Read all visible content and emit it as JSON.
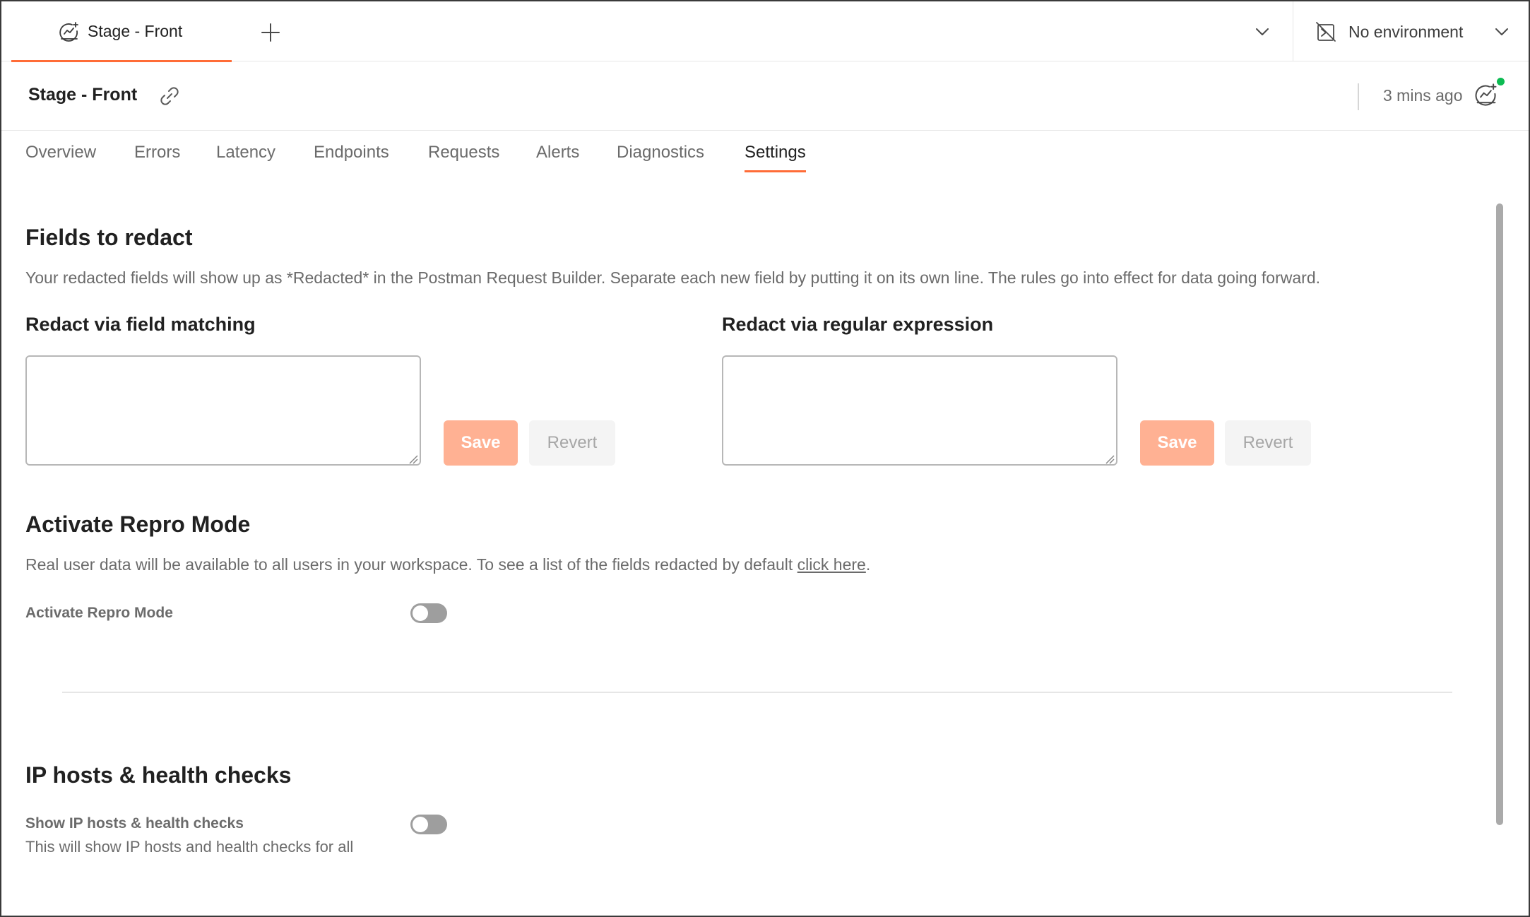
{
  "tabbar": {
    "tab_label": "Stage - Front",
    "environment_label": "No environment"
  },
  "header": {
    "title": "Stage - Front",
    "last_updated": "3 mins ago"
  },
  "nav": {
    "items": [
      "Overview",
      "Errors",
      "Latency",
      "Endpoints",
      "Requests",
      "Alerts",
      "Diagnostics",
      "Settings"
    ],
    "active": "Settings"
  },
  "redact": {
    "title": "Fields to redact",
    "description": "Your redacted fields will show up as *Redacted* in the Postman Request Builder. Separate each new field by putting it on its own line. The rules go into effect for data going forward.",
    "field_matching": {
      "title": "Redact via field matching",
      "value": "",
      "save_label": "Save",
      "revert_label": "Revert"
    },
    "regex": {
      "title": "Redact via regular expression",
      "value": "",
      "save_label": "Save",
      "revert_label": "Revert"
    }
  },
  "repro": {
    "title": "Activate Repro Mode",
    "description_prefix": "Real user data will be available to all users in your workspace. To see a list of the fields redacted by default ",
    "link_text": "click here",
    "description_suffix": ".",
    "toggle_label": "Activate Repro Mode",
    "toggle_on": false
  },
  "ip_hosts": {
    "title": "IP hosts & health checks",
    "toggle_label": "Show IP hosts & health checks",
    "toggle_description": "This will show IP hosts and health checks for all",
    "toggle_on": false
  },
  "colors": {
    "accent": "#ff6c37",
    "save_button": "#ffb193",
    "status_online": "#0cbb52"
  },
  "icons": {
    "tab": "monitor-icon",
    "add": "plus-icon",
    "dropdown": "chevron-down-icon",
    "environment": "no-environment-icon",
    "copy_link": "link-icon",
    "status": "monitor-icon"
  }
}
